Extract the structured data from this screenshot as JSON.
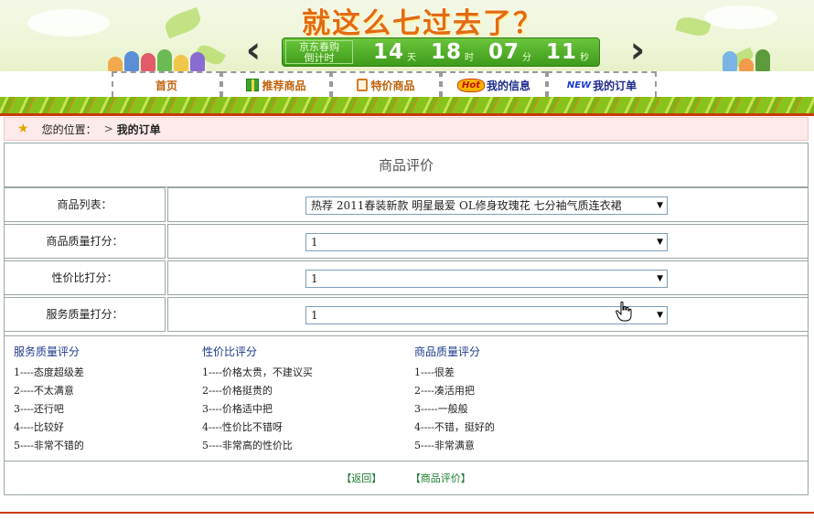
{
  "header": {
    "slogan": "就这么七过去了？",
    "countdown_label": "京东春购\n倒计时",
    "countdown": [
      {
        "num": "14",
        "unit": "天"
      },
      {
        "num": "18",
        "unit": "时"
      },
      {
        "num": "07",
        "unit": "分"
      },
      {
        "num": "11",
        "unit": "秒"
      }
    ]
  },
  "nav": {
    "home": "首页",
    "recommended": "推荐商品",
    "special": "特价商品",
    "my_info": "我的信息",
    "my_orders": "我的订单",
    "hot_badge": "Hot",
    "new_badge": "NEW"
  },
  "breadcrumb": {
    "prefix": "您的位置：",
    "current": "我的订单"
  },
  "panel": {
    "title": "商品评价",
    "rows": [
      {
        "label": "商品列表：",
        "value": "热荐 2011春装新款 明星最爱 OL修身玫瑰花 七分袖气质连衣裙"
      },
      {
        "label": "商品质量打分：",
        "value": "1"
      },
      {
        "label": "性价比打分：",
        "value": "1"
      },
      {
        "label": "服务质量打分：",
        "value": "1"
      }
    ]
  },
  "legend": {
    "service": {
      "title": "服务质量评分",
      "items": [
        "1----态度超级差",
        "2----不太满意",
        "3----还行吧",
        "4----比较好",
        "5----非常不错的"
      ]
    },
    "value": {
      "title": "性价比评分",
      "items": [
        "1----价格太贵，不建议买",
        "2----价格挺贵的",
        "3----价格适中把",
        "4----性价比不错呀",
        "5----非常高的性价比"
      ]
    },
    "quality": {
      "title": "商品质量评分",
      "items": [
        "1----很差",
        "2----凑活用把",
        "3-----一般般",
        "4----不错，挺好的",
        "5----非常满意"
      ]
    }
  },
  "actions": {
    "back": "【返回】",
    "review": "【商品评价】"
  },
  "colors": {
    "accent_green": "#3e9a1b",
    "nav_orange": "#c0620a",
    "nav_blue": "#1e2b8c",
    "legend_title": "#1f3a8c",
    "action_link": "#1a7a2e",
    "rule_red": "#c93a10"
  }
}
